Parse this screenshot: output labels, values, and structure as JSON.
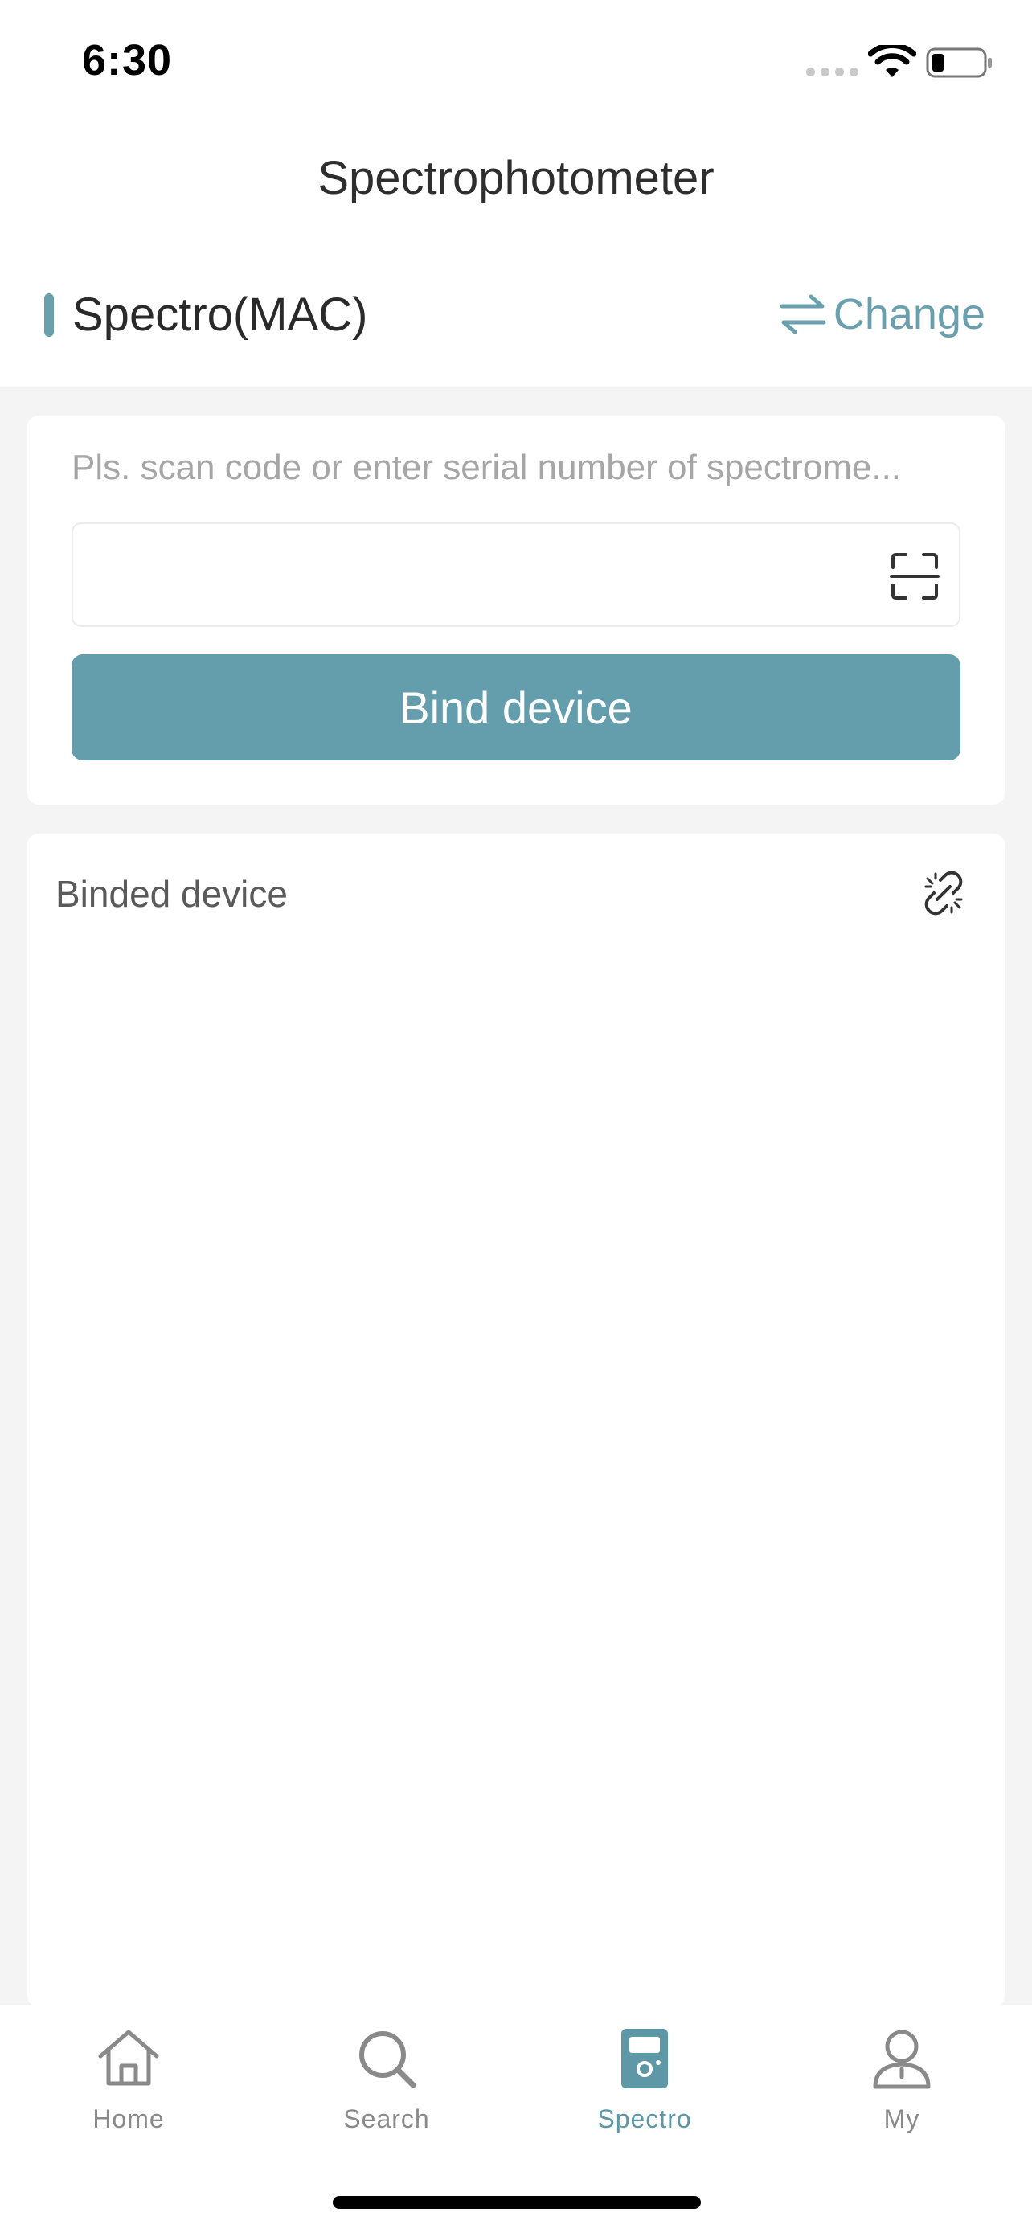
{
  "status_bar": {
    "time": "6:30"
  },
  "nav": {
    "title": "Spectrophotometer"
  },
  "section": {
    "title": "Spectro(MAC)",
    "change_label": "Change",
    "accent_color": "#6aa0ae"
  },
  "bind": {
    "hint": "Pls. scan code or enter serial number of spectrome...",
    "serial_value": "",
    "button_label": "Bind device",
    "button_color": "#649ead"
  },
  "binded": {
    "title": "Binded device",
    "icon": "unlink-icon"
  },
  "tabs": [
    {
      "label": "Home",
      "icon": "home-icon",
      "active": false
    },
    {
      "label": "Search",
      "icon": "search-icon",
      "active": false
    },
    {
      "label": "Spectro",
      "icon": "spectro-device-icon",
      "active": true
    },
    {
      "label": "My",
      "icon": "user-icon",
      "active": false
    }
  ]
}
